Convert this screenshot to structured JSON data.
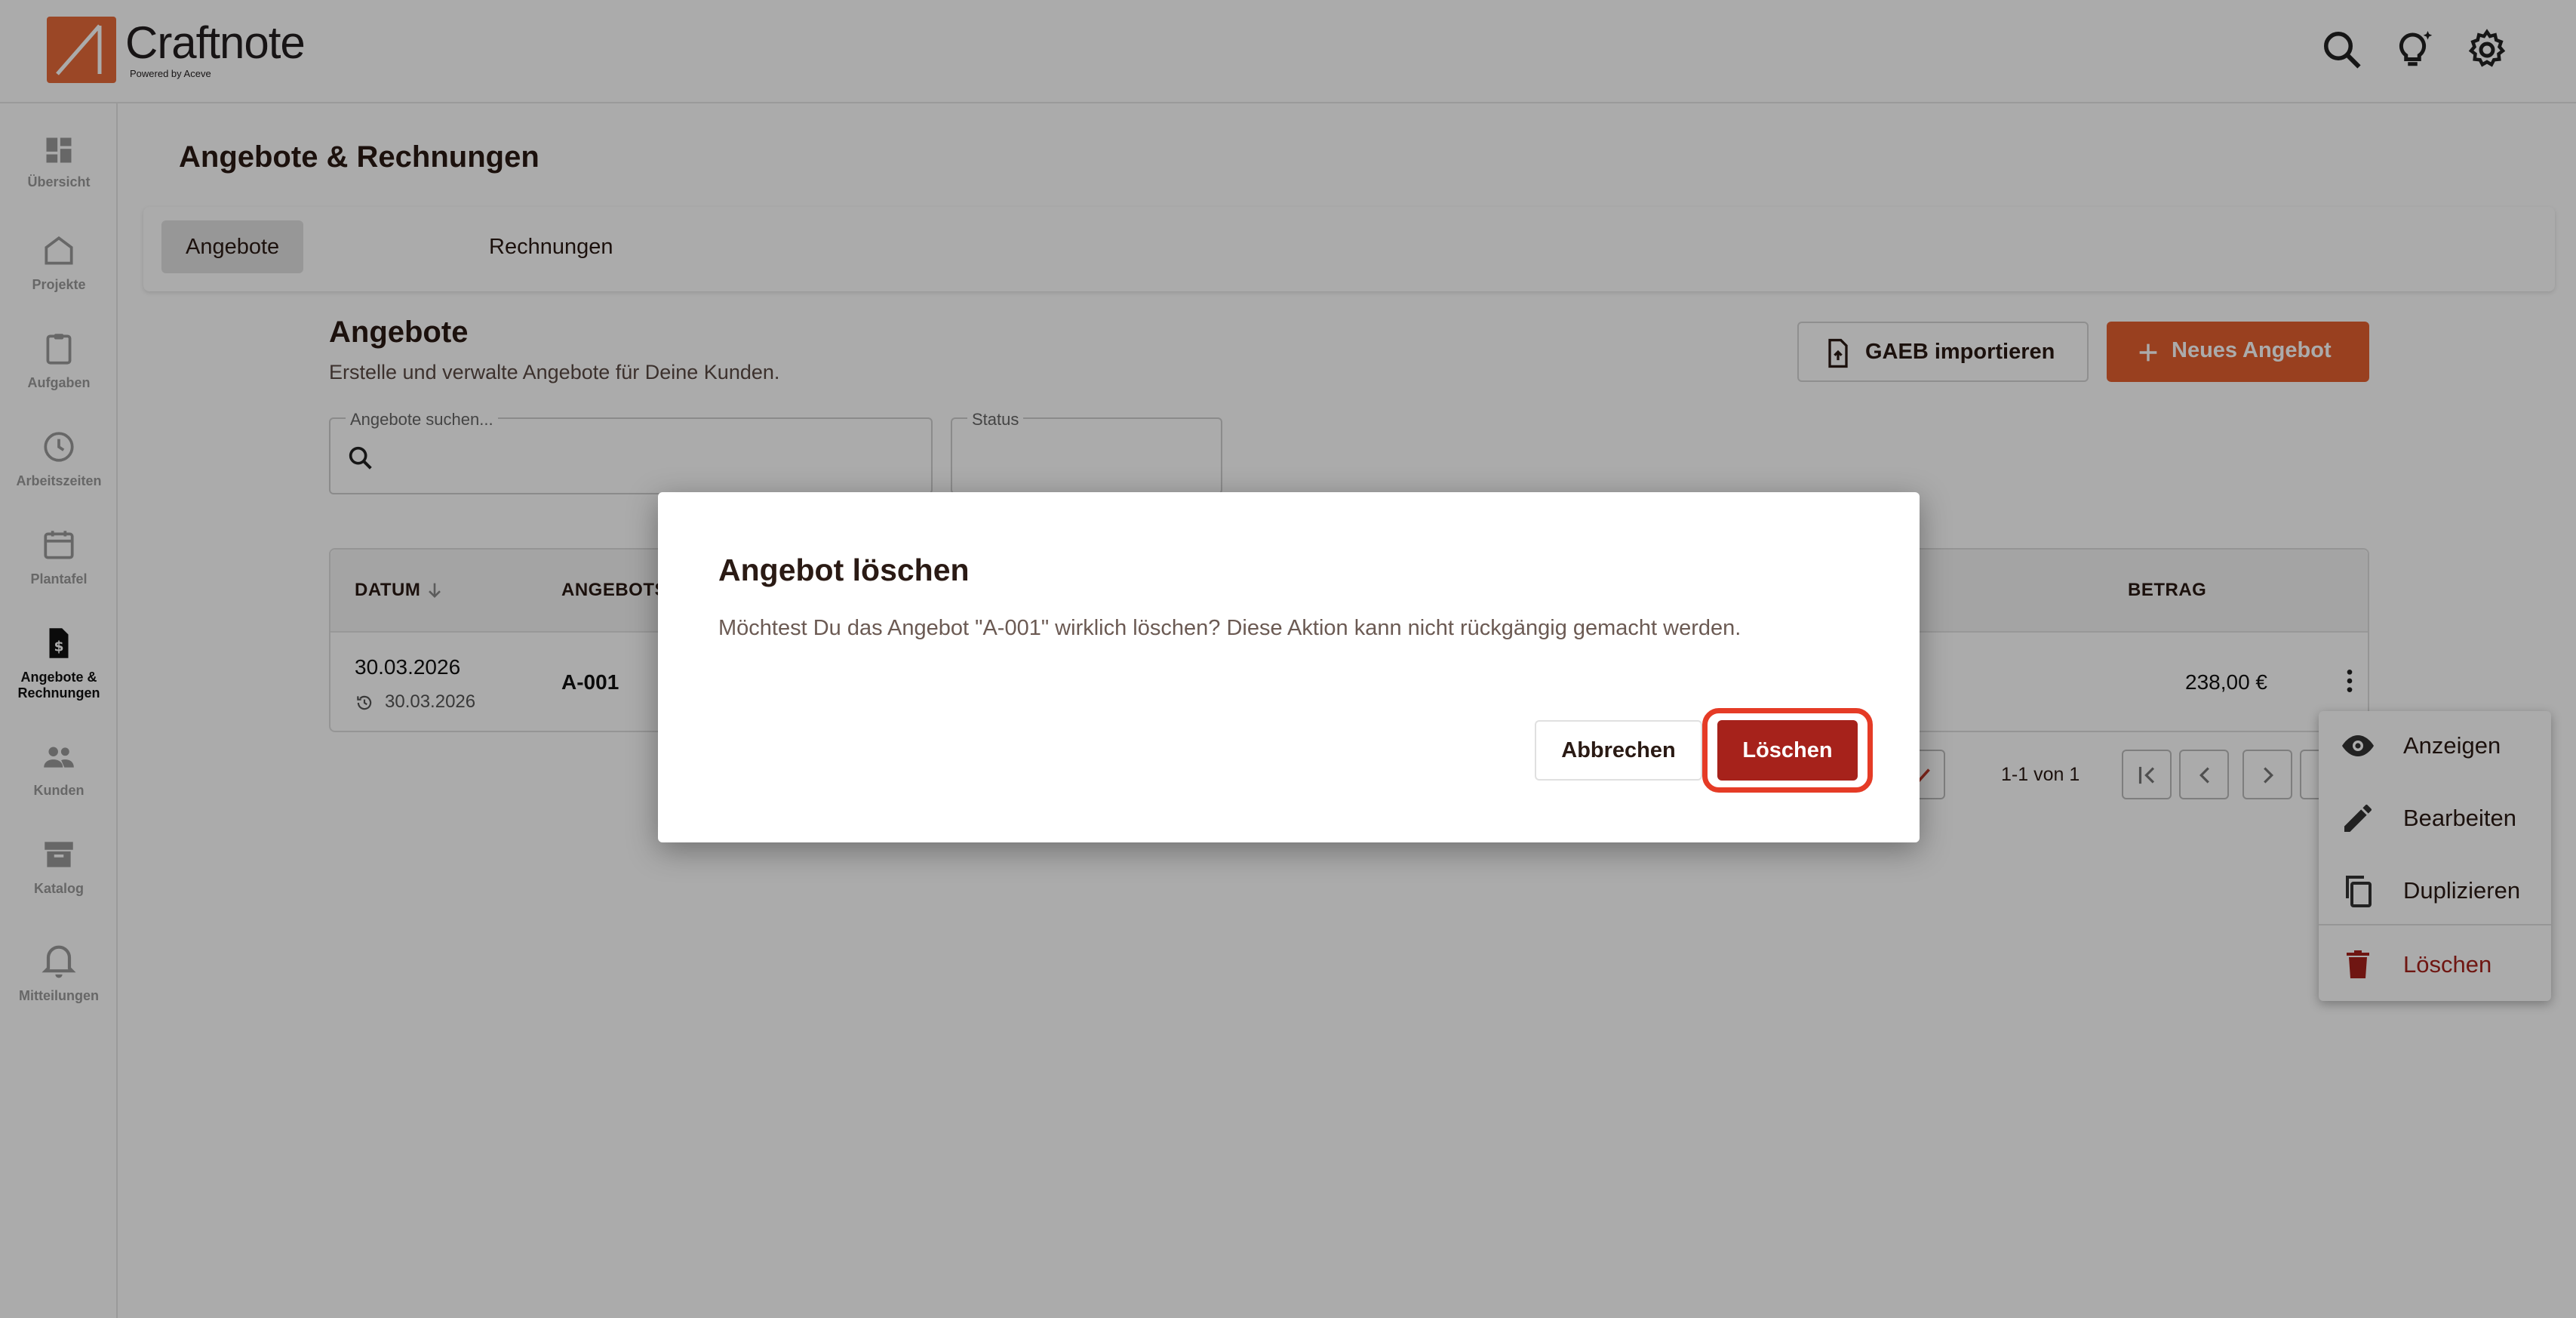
{
  "app": {
    "name": "Craftnote",
    "tagline": "Powered by Aceve"
  },
  "header": {
    "icons": [
      "search-icon",
      "lightbulb-sparkle-icon",
      "gear-icon"
    ]
  },
  "sidebar": {
    "items": [
      {
        "label": "Übersicht",
        "icon": "dashboard-icon"
      },
      {
        "label": "Projekte",
        "icon": "home-icon"
      },
      {
        "label": "Aufgaben",
        "icon": "clipboard-icon"
      },
      {
        "label": "Arbeitszeiten",
        "icon": "clock-icon"
      },
      {
        "label": "Plantafel",
        "icon": "calendar-icon"
      },
      {
        "label": "Angebote & Rechnungen",
        "icon": "invoice-icon",
        "active": true
      },
      {
        "label": "Kunden",
        "icon": "people-icon"
      },
      {
        "label": "Katalog",
        "icon": "archive-icon"
      },
      {
        "label": "Mitteilungen",
        "icon": "bell-icon"
      }
    ]
  },
  "page": {
    "title": "Angebote & Rechnungen",
    "tabs": [
      {
        "label": "Angebote",
        "active": true
      },
      {
        "label": "Rechnungen",
        "active": false
      }
    ]
  },
  "section": {
    "title": "Angebote",
    "subtitle": "Erstelle und verwalte Angebote für Deine Kunden.",
    "import_label": "GAEB importieren",
    "new_label": "Neues Angebot",
    "search_label": "Angebote suchen...",
    "search_value": "",
    "status_label": "Status",
    "status_value": ""
  },
  "table": {
    "headers": {
      "date": "DATUM",
      "number": "ANGEBOTS",
      "amount": "BETRAG"
    },
    "rows": [
      {
        "date": "30.03.2026",
        "modified": "30.03.2026",
        "number": "A-001",
        "amount": "238,00 €"
      }
    ],
    "pagination": "1-1 von 1"
  },
  "context_menu": {
    "items": [
      {
        "label": "Anzeigen",
        "icon": "eye-icon"
      },
      {
        "label": "Bearbeiten",
        "icon": "pencil-icon"
      },
      {
        "label": "Duplizieren",
        "icon": "copy-icon"
      },
      {
        "label": "Löschen",
        "icon": "trash-icon",
        "color": "#a6221b"
      }
    ]
  },
  "dialog": {
    "title": "Angebot löschen",
    "message": "Möchtest Du das Angebot \"A-001\" wirklich löschen? Diese Aktion kann nicht rückgängig gemacht werden.",
    "cancel_label": "Abbrechen",
    "confirm_label": "Löschen"
  },
  "colors": {
    "brand": "#e4602f",
    "danger": "#a6221b",
    "highlight_ring": "#e53b26"
  }
}
